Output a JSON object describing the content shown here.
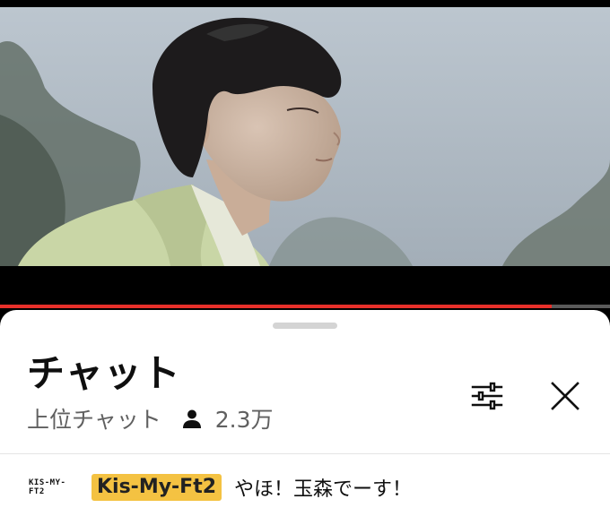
{
  "player": {
    "progress": 0.905
  },
  "chat_panel": {
    "title": "チャット",
    "mode_label": "上位チャット",
    "viewer_count": "2.3万",
    "filter_icon": "sliders-icon",
    "close_icon": "close-icon"
  },
  "messages": [
    {
      "author_avatar_text": "KIS-MY-FT2",
      "author_name": "Kis-My-Ft2",
      "text": "やほ！玉森でーす！"
    }
  ],
  "colors": {
    "progress": "#e8302a",
    "member_badge": "#f4c242"
  }
}
